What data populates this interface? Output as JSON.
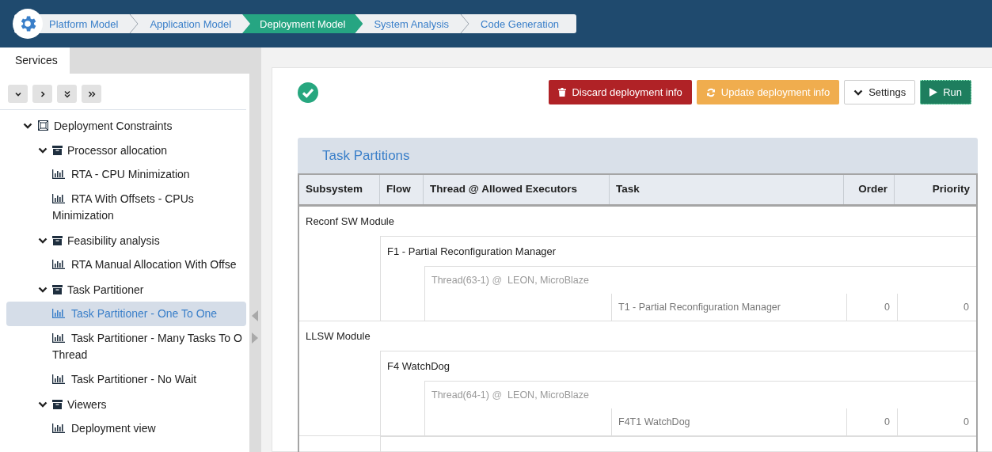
{
  "steps": [
    {
      "label": "Platform Model",
      "selected": false
    },
    {
      "label": "Application Model",
      "selected": false
    },
    {
      "label": "Deployment Model",
      "selected": true
    },
    {
      "label": "System Analysis",
      "selected": false
    },
    {
      "label": "Code Generation",
      "selected": false
    }
  ],
  "sidebar": {
    "tab": "Services",
    "tree": [
      {
        "kind": "root",
        "label": "Deployment Constraints",
        "expanded": true,
        "children": [
          {
            "kind": "folder",
            "label": "Processor allocation",
            "expanded": true,
            "children": [
              {
                "kind": "chart",
                "label": "RTA - CPU Minimization",
                "selected": false
              },
              {
                "kind": "chart",
                "label": "RTA With Offsets - CPUs\nMinimization",
                "selected": false
              }
            ]
          },
          {
            "kind": "folder",
            "label": "Feasibility analysis",
            "expanded": true,
            "children": [
              {
                "kind": "chart",
                "label": "RTA Manual Allocation With Offse",
                "selected": false
              }
            ]
          },
          {
            "kind": "folder",
            "label": "Task Partitioner",
            "expanded": true,
            "children": [
              {
                "kind": "chart",
                "label": "Task Partitioner - One To One",
                "selected": true
              },
              {
                "kind": "chart",
                "label": "Task Partitioner - Many Tasks To O\nThread",
                "selected": false
              },
              {
                "kind": "chart",
                "label": "Task Partitioner - No Wait",
                "selected": false
              }
            ]
          },
          {
            "kind": "folder",
            "label": "Viewers",
            "expanded": true,
            "children": [
              {
                "kind": "chart",
                "label": "Deployment view",
                "selected": false
              }
            ]
          }
        ]
      }
    ]
  },
  "toolbar": {
    "buttons": [
      {
        "kind": "danger",
        "label": "Discard deployment info"
      },
      {
        "kind": "warning",
        "label": "Update deployment info"
      },
      {
        "kind": "settings",
        "label": "Settings"
      },
      {
        "kind": "run",
        "label": "Run"
      }
    ]
  },
  "panel": {
    "title": "Task Partitions",
    "columns": [
      "Subsystem",
      "Flow",
      "Thread @ Allowed Executors",
      "Task",
      "Order",
      "Priority"
    ],
    "subsystems": [
      {
        "name": "Reconf SW Module",
        "flows": [
          {
            "name": "F1 - Partial Reconfiguration Manager",
            "threads": [
              {
                "name": "Thread(63-1)",
                "at": "@",
                "executors": "LEON, MicroBlaze",
                "tasks": [
                  {
                    "name": "T1 - Partial Reconfiguration Manager",
                    "order": "0",
                    "priority": "0"
                  }
                ]
              }
            ]
          }
        ]
      },
      {
        "name": "LLSW Module",
        "flows": [
          {
            "name": "F4 WatchDog",
            "threads": [
              {
                "name": "Thread(64-1)",
                "at": "@",
                "executors": "LEON, MicroBlaze",
                "tasks": [
                  {
                    "name": "F4T1 WatchDog",
                    "order": "0",
                    "priority": "0"
                  }
                ]
              }
            ]
          }
        ]
      }
    ]
  }
}
